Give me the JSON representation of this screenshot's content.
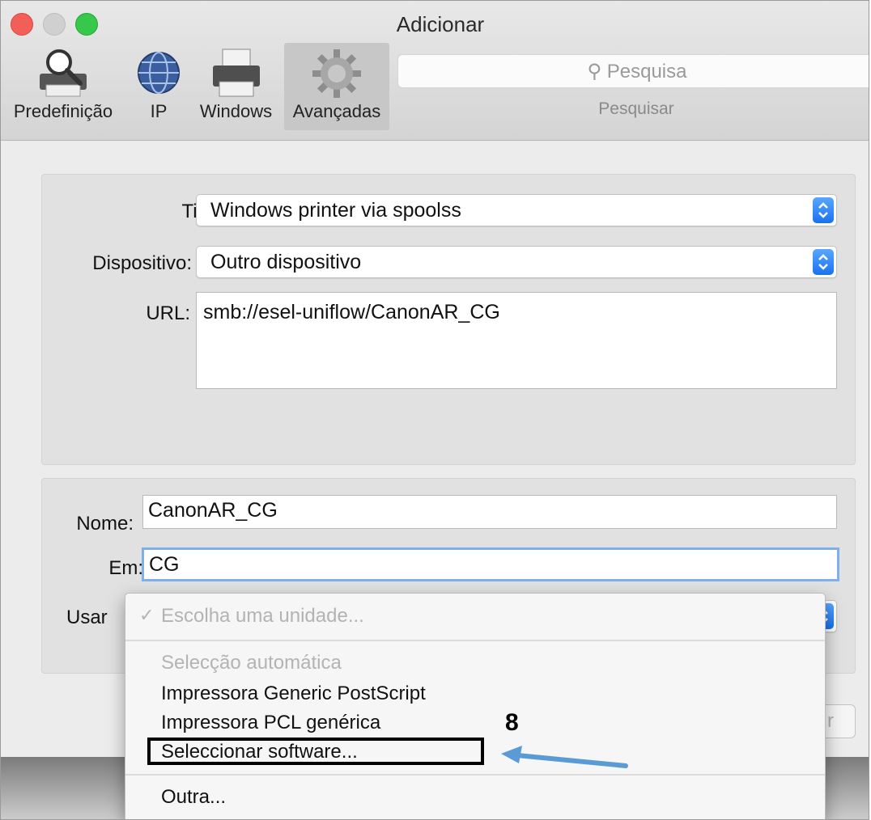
{
  "window": {
    "title": "Adicionar"
  },
  "toolbar": {
    "items": [
      {
        "label": "Predefinição",
        "icon": "default-printer-icon"
      },
      {
        "label": "IP",
        "icon": "globe-icon"
      },
      {
        "label": "Windows",
        "icon": "printer-icon"
      },
      {
        "label": "Avançadas",
        "icon": "gear-icon"
      }
    ],
    "search_placeholder": "Pesquisa",
    "search_caption": "Pesquisar"
  },
  "form": {
    "tipo_label": "Tipo:",
    "tipo_value": "Windows printer via spoolss",
    "dispositivo_label": "Dispositivo:",
    "dispositivo_value": "Outro dispositivo",
    "url_label": "URL:",
    "url_value": "smb://esel-uniflow/CanonAR_CG",
    "nome_label": "Nome:",
    "nome_value": "CanonAR_CG",
    "em_label": "Em:",
    "em_value": "CG",
    "usar_label": "Usar"
  },
  "menu": {
    "items": [
      {
        "label": "Escolha uma unidade...",
        "checked": true,
        "enabled": false
      },
      {
        "label": "Selecção automática",
        "enabled": false
      },
      {
        "label": "Impressora Generic PostScript",
        "enabled": true
      },
      {
        "label": "Impressora PCL genérica",
        "enabled": true
      },
      {
        "label": "Seleccionar software...",
        "enabled": true
      },
      {
        "label": "Outra...",
        "enabled": true
      }
    ]
  },
  "annotation": {
    "step_number": "8",
    "arrow_color": "#5b9bd5"
  },
  "colors": {
    "accent": "#1a72f0",
    "close": "#f25f58",
    "maximize": "#35c84a"
  }
}
